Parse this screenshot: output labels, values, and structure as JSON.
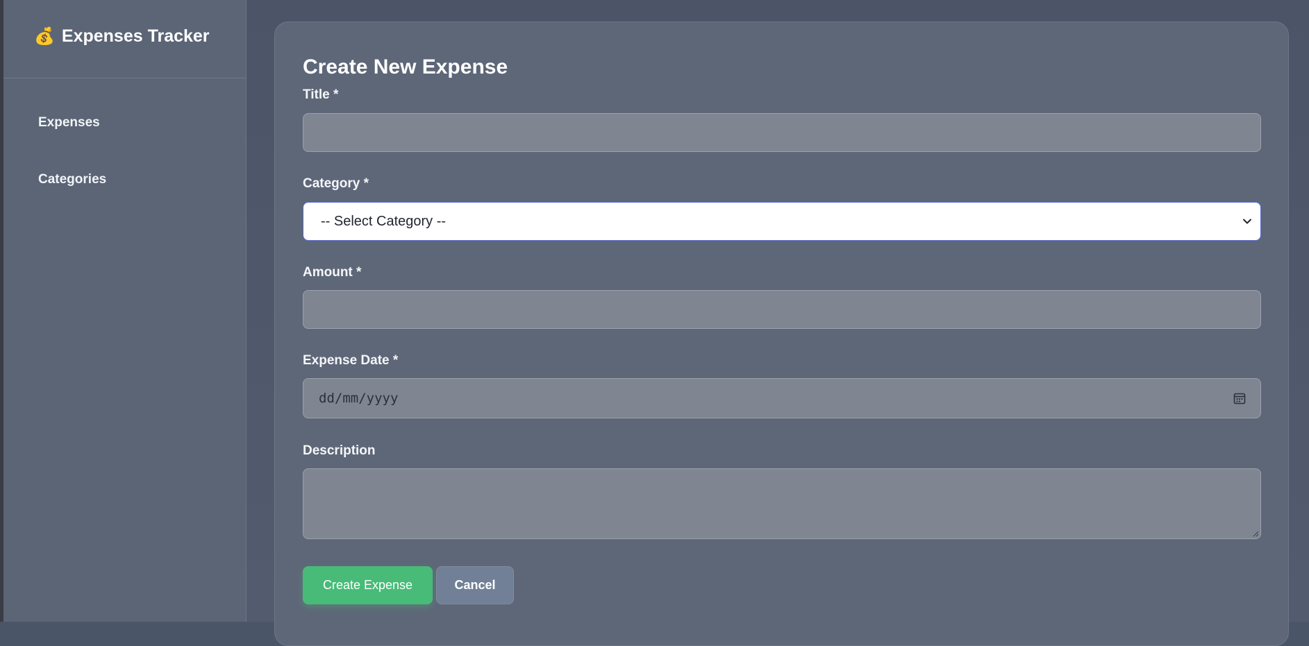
{
  "sidebar": {
    "brand_icon": "💰",
    "brand_title": "Expenses Tracker",
    "items": [
      {
        "label": "Expenses"
      },
      {
        "label": "Categories"
      }
    ]
  },
  "form": {
    "title": "Create New Expense",
    "title_label": "Title *",
    "title_value": "",
    "category_label": "Category *",
    "category_selected": "-- Select Category --",
    "amount_label": "Amount *",
    "amount_value": "",
    "date_label": "Expense Date *",
    "date_placeholder": "dd/mm/yyyy",
    "description_label": "Description",
    "description_value": "",
    "create_button": "Create Expense",
    "cancel_button": "Cancel"
  },
  "colors": {
    "accent_green": "#48bb78",
    "cancel_gray": "#718096",
    "select_focus_border": "#5b6bd0"
  },
  "icons": {
    "brand": "money-bag-icon",
    "select": "chevron-down-icon",
    "date": "calendar-icon",
    "textarea": "resize-grip-icon"
  }
}
